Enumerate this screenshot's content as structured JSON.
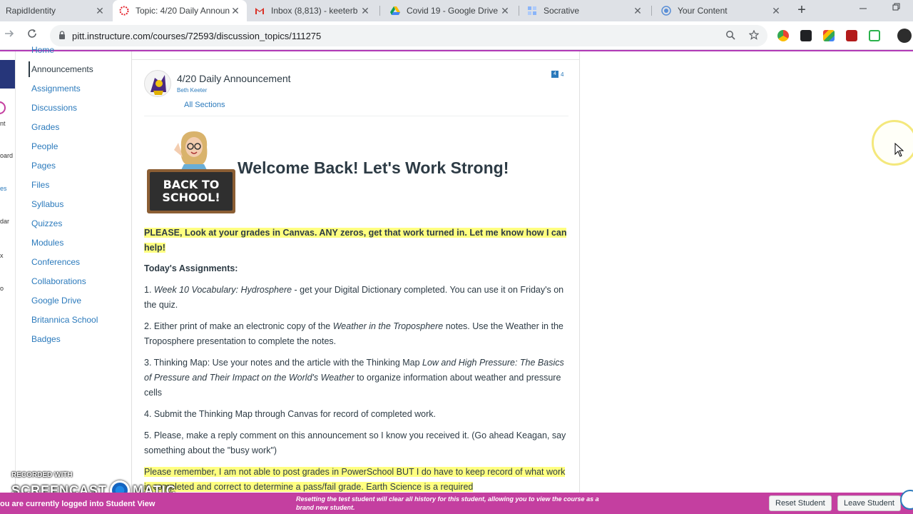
{
  "browser": {
    "tabs": [
      {
        "title": "RapidIdentity",
        "icon": "rapididentity-icon",
        "active": false
      },
      {
        "title": "Topic: 4/20 Daily Announ",
        "icon": "canvas-icon",
        "active": true
      },
      {
        "title": "Inbox (8,813) - keeterb",
        "icon": "gmail-icon",
        "active": false
      },
      {
        "title": "Covid 19 - Google Drive",
        "icon": "drive-icon",
        "active": false
      },
      {
        "title": "Socrative",
        "icon": "socrative-icon",
        "active": false
      },
      {
        "title": "Your Content",
        "icon": "screencast-icon",
        "active": false
      }
    ],
    "new_tab": "+",
    "close_glyph": "✕",
    "url": "pitt.instructure.com/courses/72593/discussion_topics/111275"
  },
  "global_nav": {
    "fragments": [
      "nt",
      "oard",
      "es",
      "dar",
      "x",
      "o"
    ]
  },
  "course_nav": {
    "items": [
      {
        "label": "Home",
        "active": false
      },
      {
        "label": "Announcements",
        "active": true
      },
      {
        "label": "Assignments",
        "active": false
      },
      {
        "label": "Discussions",
        "active": false
      },
      {
        "label": "Grades",
        "active": false
      },
      {
        "label": "People",
        "active": false
      },
      {
        "label": "Pages",
        "active": false
      },
      {
        "label": "Files",
        "active": false
      },
      {
        "label": "Syllabus",
        "active": false
      },
      {
        "label": "Quizzes",
        "active": false
      },
      {
        "label": "Modules",
        "active": false
      },
      {
        "label": "Conferences",
        "active": false
      },
      {
        "label": "Collaborations",
        "active": false
      },
      {
        "label": "Google Drive",
        "active": false
      },
      {
        "label": "Britannica School",
        "active": false
      },
      {
        "label": "Badges",
        "active": false
      }
    ]
  },
  "post": {
    "title": "4/20 Daily Announcement",
    "author": "Beth Keeter",
    "sections": "All Sections",
    "reply_count_badge": "4",
    "reply_count": "4",
    "bitmoji_sign": "BACK TO SCHOOL!",
    "heading": "Welcome Back!  Let's Work Strong!",
    "p1": "PLEASE, Look at your grades in Canvas.  ANY zeros, get that work turned in.  Let me know how I can help!",
    "assignments_heading": "Today's Assignments:",
    "item1_num": "1. ",
    "item1_italic": "Week 10 Vocabulary: Hydrosphere",
    "item1_rest": "  - get your Digital Dictionary completed.  You can use it on Friday's on the quiz.",
    "item2_pre": "2. Either print of make an electronic copy of the ",
    "item2_italic": "Weather in the Troposphere",
    "item2_rest": " notes.  Use the Weather in the Troposphere presentation to complete the notes.",
    "item3_pre": "3. Thinking Map: Use your notes and the article with the Thinking Map ",
    "item3_italic": "Low and High Pressure: The Basics of Pressure and Their Impact on the World's Weather",
    "item3_rest": " to organize information about weather and pressure cells",
    "item4": "4. Submit the Thinking Map through Canvas for record of completed work.",
    "item5": "5. Please, make a reply comment on this announcement so I know you received it. (Go ahead Keagan, say something about the \"busy work\")",
    "p_last": "Please remember, I am not able to post grades in PowerSchool BUT I do have to keep record of what work is completed and correct to determine a pass/fail grade.  Earth Science is a required"
  },
  "student_bar": {
    "left": "ou are currently logged into Student View",
    "middle": "Resetting the test student will clear all history for this student, allowing you to view the course as a brand new student.",
    "reset_button": "Reset Student",
    "leave_button": "Leave Student"
  },
  "watermark": {
    "recorded": "RECORDED WITH",
    "brand_left": "SCREENCAST",
    "brand_right": "MATIC"
  },
  "colors": {
    "canvas_blue": "#2b7abc",
    "student_bar": "#c43fa0",
    "highlight": "#ffff80"
  }
}
